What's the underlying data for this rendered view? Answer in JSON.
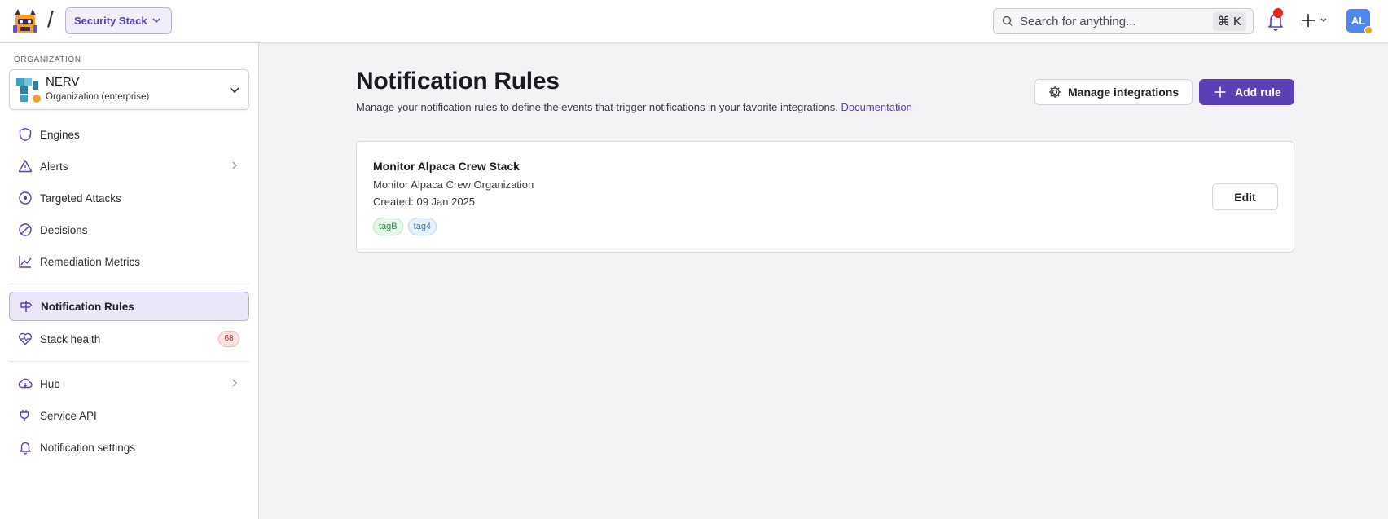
{
  "header": {
    "stack_selector": "Security Stack",
    "search_placeholder": "Search for anything...",
    "search_shortcut": "⌘ K",
    "avatar_initials": "AL"
  },
  "sidebar": {
    "org_label": "ORGANIZATION",
    "org_name": "NERV",
    "org_type": "Organization (enterprise)",
    "items": [
      {
        "label": "Engines",
        "icon": "shield-icon"
      },
      {
        "label": "Alerts",
        "icon": "warning-icon"
      },
      {
        "label": "Targeted Attacks",
        "icon": "target-icon"
      },
      {
        "label": "Decisions",
        "icon": "ban-icon"
      },
      {
        "label": "Remediation Metrics",
        "icon": "line-chart-icon"
      },
      {
        "label": "Notification Rules",
        "icon": "signpost-icon"
      },
      {
        "label": "Stack health",
        "icon": "heartbeat-icon",
        "badge": "68"
      },
      {
        "label": "Hub",
        "icon": "cloud-download-icon"
      },
      {
        "label": "Service API",
        "icon": "plug-icon"
      },
      {
        "label": "Notification settings",
        "icon": "bell-icon"
      }
    ]
  },
  "main": {
    "title": "Notification Rules",
    "description": "Manage your notification rules to define the events that trigger notifications in your favorite integrations.",
    "doc_link": "Documentation",
    "manage_button": "Manage integrations",
    "add_button": "Add rule",
    "rules": [
      {
        "name": "Monitor Alpaca Crew Stack",
        "organization": "Monitor Alpaca Crew Organization",
        "created": "Created: 09 Jan 2025",
        "tags": [
          "tagB",
          "tag4"
        ],
        "edit_label": "Edit"
      }
    ]
  },
  "colors": {
    "accent": "#5b3fb5",
    "active_bg": "#ebe7f8",
    "badge_red": "#c0262d",
    "avatar_blue": "#4f86f0"
  }
}
